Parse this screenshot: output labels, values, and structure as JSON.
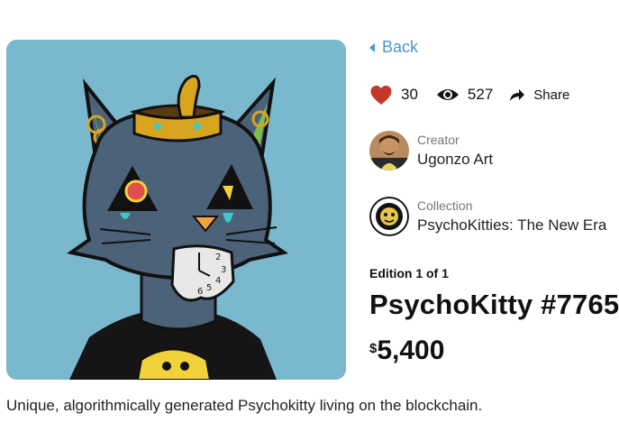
{
  "artwork": {
    "alt": "PsychoKitty #7765 artwork"
  },
  "nav": {
    "back_label": "Back"
  },
  "stats": {
    "likes": "30",
    "views": "527",
    "share_label": "Share",
    "heart_color": "#c0392b",
    "icons": [
      "heart-icon",
      "eye-icon",
      "share-arrow-icon"
    ]
  },
  "creator": {
    "label": "Creator",
    "name": "Ugonzo Art"
  },
  "collection": {
    "label": "Collection",
    "name": "PsychoKitties: The New Era"
  },
  "edition": "Edition 1 of 1",
  "title": "PsychoKitty #7765",
  "price": {
    "currency": "$",
    "amount": "5,400"
  },
  "description": "Unique, algorithmically generated Psychokitty living on the blockchain.",
  "colors": {
    "accent": "#4a97c9",
    "artwork_bg": "#7ab8cd"
  }
}
